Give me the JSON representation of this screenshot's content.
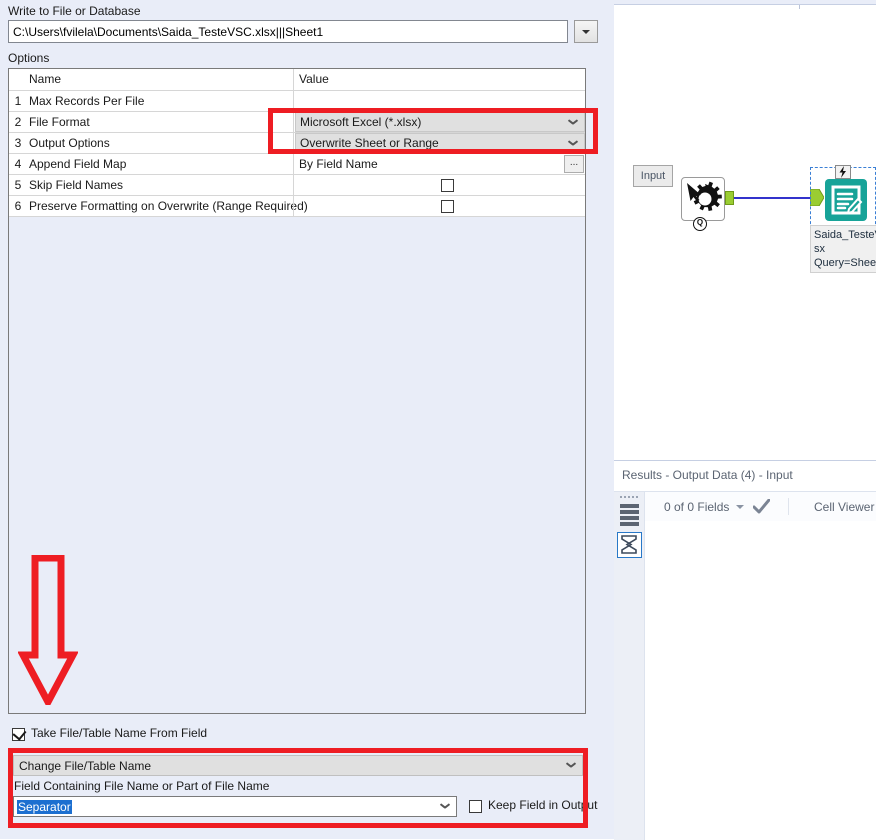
{
  "config": {
    "write_label": "Write to File or Database",
    "filepath_value": "C:\\Users\\fvilela\\Documents\\Saida_TesteVSC.xlsx|||Sheet1",
    "filepath_dropdown_icon": "chevron-down-icon",
    "options_label": "Options",
    "table": {
      "columns": [
        "Name",
        "Value"
      ],
      "rows": [
        {
          "num": "1",
          "name": "Max Records Per File",
          "value": "",
          "kind": "text"
        },
        {
          "num": "2",
          "name": "File Format",
          "value": "Microsoft Excel (*.xlsx)",
          "kind": "combo"
        },
        {
          "num": "3",
          "name": "Output Options",
          "value": "Overwrite Sheet or Range",
          "kind": "combo"
        },
        {
          "num": "4",
          "name": "Append Field Map",
          "value": "By Field Name",
          "kind": "text-ellipsis",
          "ellipsis_label": "..."
        },
        {
          "num": "5",
          "name": "Skip Field Names",
          "value": "",
          "kind": "checkbox",
          "checked": false
        },
        {
          "num": "6",
          "name": "Preserve Formatting on Overwrite (Range Required)",
          "value": "",
          "kind": "checkbox",
          "checked": false
        }
      ]
    },
    "take_name_checkbox_label": "Take File/Table Name From Field",
    "take_name_checked": true,
    "change_name_combo_value": "Change File/Table Name",
    "field_containing_label": "Field Containing File Name or Part of File Name",
    "separator_value": "Separator",
    "keep_field_label": "Keep Field in Output",
    "keep_field_checked": false
  },
  "annotations": {
    "highlight_color": "#ee1d23",
    "arrow_direction": "down",
    "arrow_name": "red-down-arrow"
  },
  "canvas": {
    "input_node_label": "Input",
    "gear_badge": "Q",
    "output_node_caption_line1": "Saida_TesteVS",
    "output_node_caption_line2": "sx",
    "output_node_caption_line3": "Query=Sheet",
    "connection_color": "#3333cc",
    "output_node_color": "#17a398",
    "plug_color": "#9acd32"
  },
  "results": {
    "title": "Results - Output Data (4) - Input",
    "fields_count": "0 of 0 Fields",
    "cell_viewer_label": "Cell Viewer",
    "sidebar_icons": [
      "records-icon",
      "sigma-icon"
    ]
  }
}
